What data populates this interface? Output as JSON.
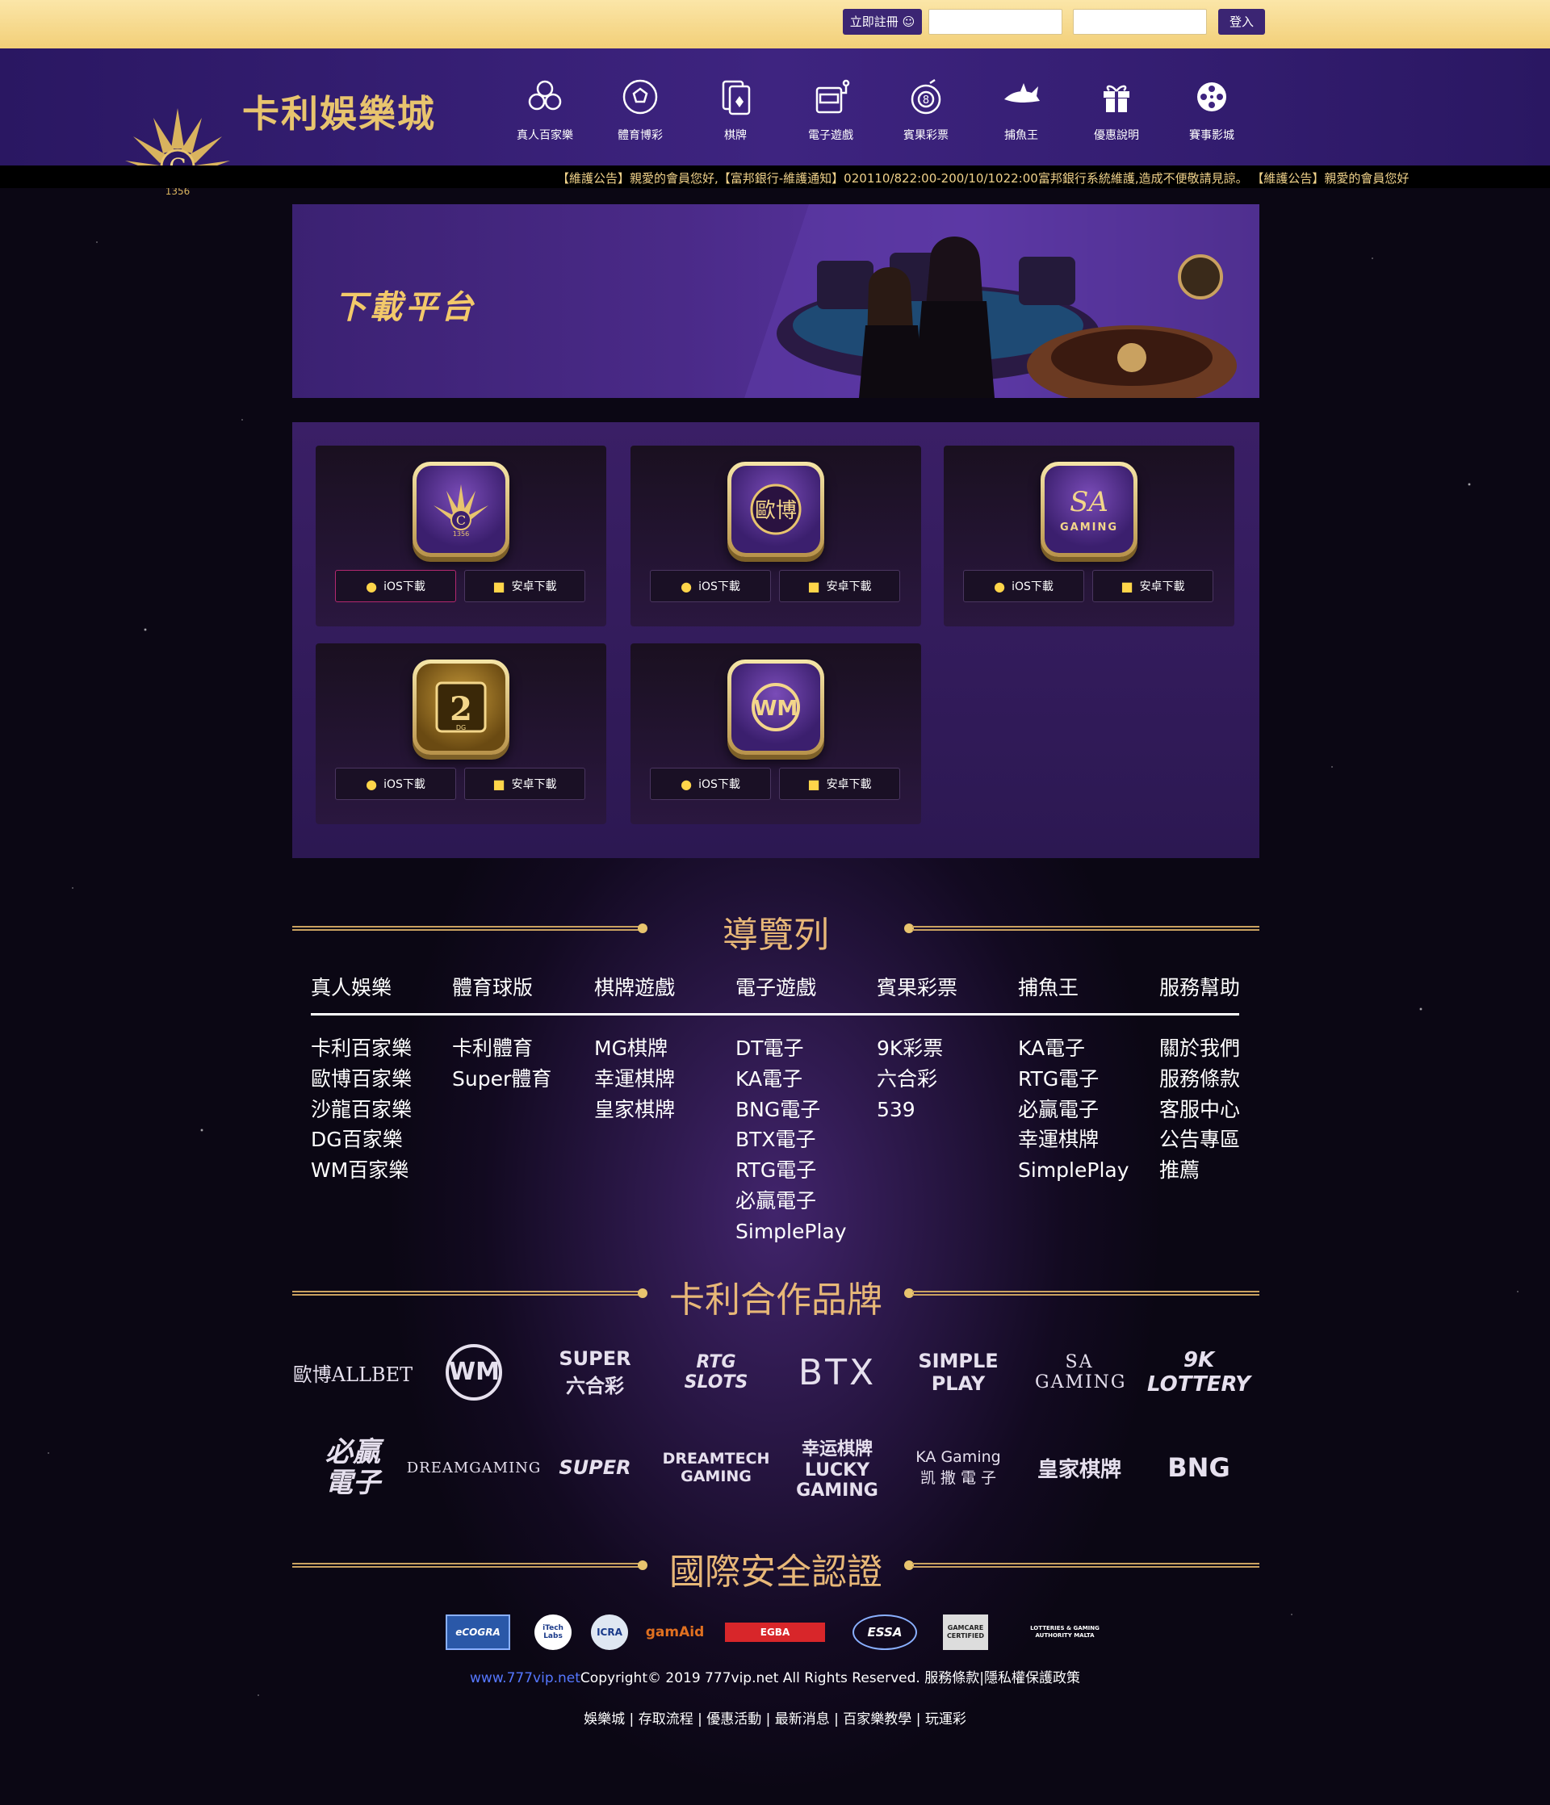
{
  "topbar": {
    "register_label": "立即註冊",
    "login_label": "登入",
    "username_placeholder": "",
    "password_placeholder": ""
  },
  "header": {
    "logo_text": "卡利娛樂城",
    "logo_number": "1356",
    "nav": [
      {
        "label": "真人百家樂",
        "icon": "chips-icon"
      },
      {
        "label": "體育博彩",
        "icon": "soccer-ball-icon"
      },
      {
        "label": "棋牌",
        "icon": "playing-card-icon"
      },
      {
        "label": "電子遊戲",
        "icon": "slot-machine-icon"
      },
      {
        "label": "賓果彩票",
        "icon": "lottery-ball-icon"
      },
      {
        "label": "捕魚王",
        "icon": "shark-icon"
      },
      {
        "label": "優惠說明",
        "icon": "gift-icon"
      },
      {
        "label": "賽事影城",
        "icon": "film-reel-icon"
      }
    ]
  },
  "marquee": {
    "text": "【維護公告】親愛的會員您好,【富邦銀行-維護通知】020110/822:00-200/10/1022:00富邦銀行系統維護,造成不便敬請見諒。 【維護公告】親愛的會員您好"
  },
  "banner": {
    "title": "下載平台"
  },
  "downloads": {
    "ios_label": "iOS下載",
    "android_label": "安卓下載",
    "apps": [
      {
        "name": "1356"
      },
      {
        "name": "歐博"
      },
      {
        "name": "SA GAMING"
      },
      {
        "name": "DG"
      },
      {
        "name": "WM"
      }
    ]
  },
  "navigation": {
    "title": "導覽列",
    "columns": [
      {
        "head": "真人娛樂",
        "items": [
          "卡利百家樂",
          "歐博百家樂",
          "沙龍百家樂",
          "DG百家樂",
          "WM百家樂"
        ]
      },
      {
        "head": "體育球版",
        "items": [
          "卡利體育",
          "Super體育"
        ]
      },
      {
        "head": "棋牌遊戲",
        "items": [
          "MG棋牌",
          "幸運棋牌",
          "皇家棋牌"
        ]
      },
      {
        "head": "電子遊戲",
        "items": [
          "DT電子",
          "KA電子",
          "BNG電子",
          "BTX電子",
          "RTG電子",
          "必贏電子",
          "SimplePlay"
        ]
      },
      {
        "head": "賓果彩票",
        "items": [
          "9K彩票",
          "六合彩",
          "539"
        ]
      },
      {
        "head": "捕魚王",
        "items": [
          "KA電子",
          "RTG電子",
          "必贏電子",
          "幸運棋牌",
          "SimplePlay"
        ]
      },
      {
        "head": "服務幫助",
        "items": [
          "關於我們",
          "服務條款",
          "客服中心",
          "公告專區",
          "推薦"
        ]
      }
    ]
  },
  "brands": {
    "title": "卡利合作品牌",
    "row1": [
      "歐博ALLBET",
      "WM",
      "SUPER 六合彩",
      "RTG SLOTS",
      "BTX",
      "SIMPLE PLAY",
      "SA GAMING",
      "9K LOTTERY"
    ],
    "row2": [
      "必贏電子",
      "DREAMGAMING",
      "SUPER",
      "DREAMTECH GAMING",
      "幸运棋牌 LUCKY GAMING",
      "KA Gaming 凯 撒 電 子",
      "皇家棋牌",
      "BNG"
    ]
  },
  "certs": {
    "title": "國際安全認證",
    "items": [
      "eCOGRA",
      "iTech Labs",
      "ICRA",
      "gamAid",
      "EGBA",
      "ESSA",
      "GAMCARE CERTIFIED",
      "LOTTERIES & GAMING AUTHORITY MALTA"
    ]
  },
  "footer": {
    "site": "www.777vip.net",
    "copyright": "Copyright© 2019 777vip.net All Rights Reserved. 服務條款|隱私權保護政策",
    "links": "娛樂城 | 存取流程 | 優惠活動 | 最新消息 | 百家樂教學 | 玩運彩"
  },
  "colors": {
    "topbar": "#f2cf78",
    "header": "#3e2480",
    "accent_gold": "#e8c46e",
    "button_purple": "#3b2573"
  }
}
